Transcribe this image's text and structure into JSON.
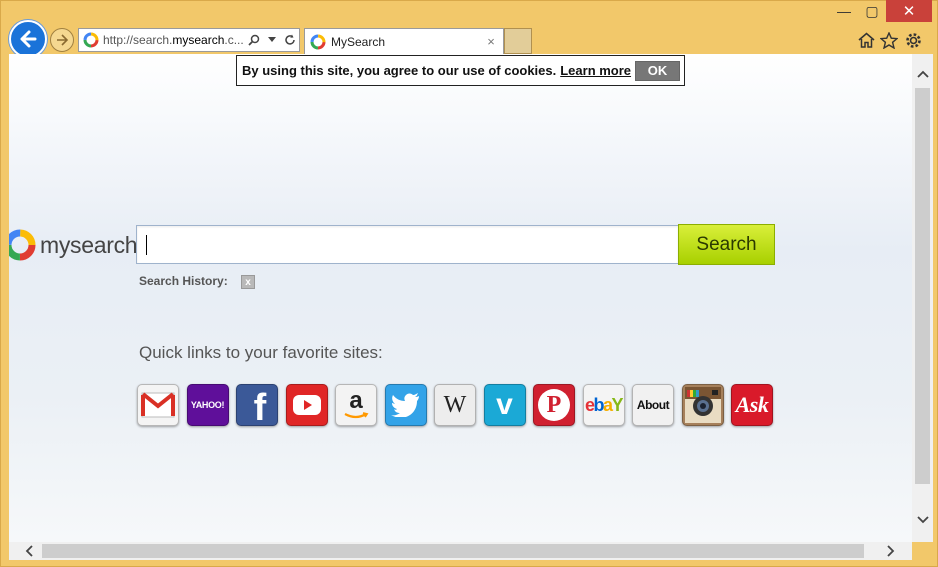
{
  "window": {
    "minimize": "—",
    "maximize": "▢",
    "close": "✕"
  },
  "address_bar": {
    "url_prefix": "http://search.",
    "url_domain": "mysearch",
    "url_suffix": ".c..."
  },
  "tab": {
    "title": "MySearch",
    "close": "×"
  },
  "cookie_banner": {
    "text": "By using this site, you agree to our use of cookies.",
    "learn_more": "Learn more",
    "ok": "OK"
  },
  "logo": {
    "text": "mysearch"
  },
  "search": {
    "button_label": "Search",
    "value": ""
  },
  "history": {
    "label": "Search History:",
    "clear": "x"
  },
  "quick_links": {
    "title": "Quick links to your favorite sites:",
    "items": [
      {
        "name": "gmail",
        "label": "M",
        "bg": "#f4f4f4",
        "fg": "#d93025"
      },
      {
        "name": "yahoo",
        "label": "YAHOO!",
        "bg": "#5f0f9a",
        "fg": "#ffffff"
      },
      {
        "name": "facebook",
        "label": "f",
        "bg": "#3b5998",
        "fg": "#ffffff"
      },
      {
        "name": "youtube",
        "label": "▶",
        "bg": "#e02626",
        "fg": "#ffffff"
      },
      {
        "name": "amazon",
        "label": "a",
        "bg": "#f3f3f3",
        "fg": "#222222"
      },
      {
        "name": "twitter",
        "label": "🐦",
        "bg": "#33a3e8",
        "fg": "#ffffff"
      },
      {
        "name": "wikipedia",
        "label": "W",
        "bg": "#ededed",
        "fg": "#222222"
      },
      {
        "name": "vimeo",
        "label": "v",
        "bg": "#1ba9d6",
        "fg": "#ffffff"
      },
      {
        "name": "pinterest",
        "label": "P",
        "bg": "#d02030",
        "fg": "#ffffff"
      },
      {
        "name": "ebay",
        "label": "ebY",
        "bg": "#f4f4f4",
        "fg": "#e53238"
      },
      {
        "name": "about",
        "label": "About",
        "bg": "#f1f1f1",
        "fg": "#111111"
      },
      {
        "name": "instagram",
        "label": "◉",
        "bg": "#a6805b",
        "fg": "#2b2b2b"
      },
      {
        "name": "ask",
        "label": "Ask",
        "bg": "#d91a2a",
        "fg": "#ffffff"
      }
    ]
  },
  "colors": {
    "accent_search": "#b5dc05",
    "back_button": "#1a73d9",
    "frame": "#f2c86a"
  }
}
